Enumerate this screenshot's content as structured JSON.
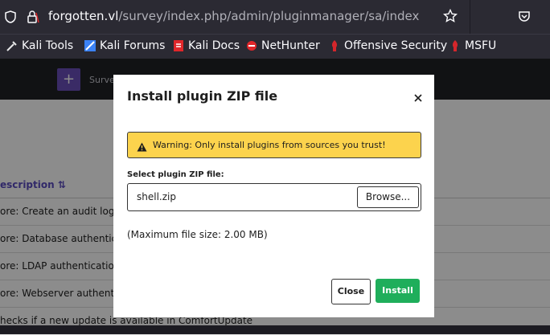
{
  "browser": {
    "url_host": "forgotten.vl",
    "url_path": "/survey/index.php/admin/pluginmanager/sa/index"
  },
  "bookmarks": [
    {
      "label": "Kali Tools",
      "icon": "kali-tools-icon",
      "color": "#e8e8e8"
    },
    {
      "label": "Kali Forums",
      "icon": "kali-forums-icon",
      "color": "#3b82f6"
    },
    {
      "label": "Kali Docs",
      "icon": "kali-docs-icon",
      "color": "#e0262a"
    },
    {
      "label": "NetHunter",
      "icon": "nethunter-icon",
      "color": "#e0262a"
    },
    {
      "label": "Offensive Security",
      "icon": "offsec-icon",
      "color": "#d4262b"
    },
    {
      "label": "MSFU",
      "icon": "msfu-icon",
      "color": "#d4262b"
    }
  ],
  "app": {
    "add_label": "+",
    "surveys_label": "Surve"
  },
  "table": {
    "header": "escription",
    "rows": [
      "ore: Create an audit log o",
      "ore: Database authentica",
      "ore: LDAP authentication",
      "ore: Webserver authentic",
      "hecks if a new update is available in ComfortUpdate"
    ]
  },
  "modal": {
    "title": "Install plugin ZIP file",
    "warning": "Warning: Only install plugins from sources you trust!",
    "file_label": "Select plugin ZIP file:",
    "file_name": "shell.zip",
    "browse_label": "Browse...",
    "max_size": "(Maximum file size: 2.00 MB)",
    "close_label": "Close",
    "install_label": "Install"
  },
  "colors": {
    "accent_purple": "#6b4fbb",
    "warning_yellow": "#fcd34d",
    "install_green": "#1fae5b"
  }
}
